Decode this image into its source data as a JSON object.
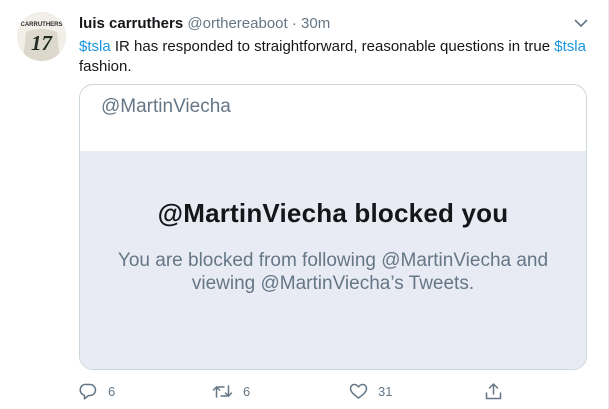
{
  "tweet": {
    "display_name": "luis carruthers",
    "handle": "@orthereaboot",
    "dot": "·",
    "time": "30m",
    "text_parts": {
      "cashtag1": "$tsla",
      "middle": " IR has responded to straightforward, reasonable questions in true ",
      "cashtag2": "$tsla",
      "end": " fashion."
    },
    "avatar": {
      "jersey_name": "CARRUTHERS",
      "jersey_number": "17"
    }
  },
  "card": {
    "header_handle": "@MartinViecha",
    "blocked_title": "@MartinViecha blocked you",
    "blocked_desc": "You are blocked from following @MartinViecha and viewing @MartinViecha’s Tweets."
  },
  "actions": {
    "reply_count": "6",
    "retweet_count": "6",
    "like_count": "31"
  },
  "icons": {
    "caret": "chevron-down-icon",
    "reply": "reply-icon",
    "retweet": "retweet-icon",
    "like": "heart-icon",
    "share": "share-icon"
  },
  "colors": {
    "link": "#1b95e0",
    "secondary_text": "#657786",
    "blocked_background": "#e8ebf3",
    "border": "#ccd6dd"
  }
}
